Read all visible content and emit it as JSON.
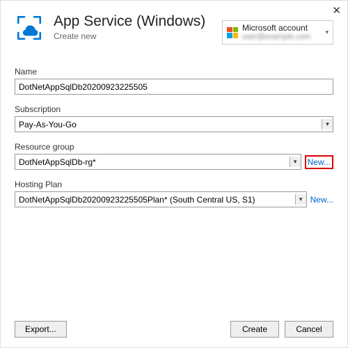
{
  "header": {
    "title": "App Service (Windows)",
    "subtitle": "Create new",
    "account_label": "Microsoft account",
    "account_email": "user@example.com"
  },
  "fields": {
    "name": {
      "label": "Name",
      "value": "DotNetAppSqlDb20200923225505"
    },
    "subscription": {
      "label": "Subscription",
      "value": "Pay-As-You-Go"
    },
    "resource_group": {
      "label": "Resource group",
      "value": "DotNetAppSqlDb-rg*",
      "new_label": "New..."
    },
    "hosting_plan": {
      "label": "Hosting Plan",
      "value": "DotNetAppSqlDb20200923225505Plan* (South Central US, S1)",
      "new_label": "New..."
    }
  },
  "footer": {
    "export": "Export...",
    "create": "Create",
    "cancel": "Cancel"
  }
}
